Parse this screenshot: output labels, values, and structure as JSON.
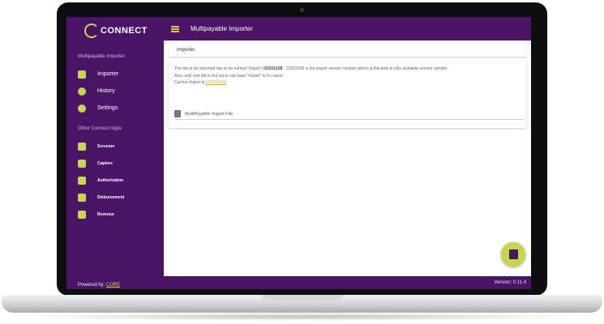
{
  "brand": {
    "name": "CONNECT"
  },
  "sidebar": {
    "section_title": "Multipayable Importer",
    "items": [
      {
        "label": "Importer",
        "icon": "import-icon"
      },
      {
        "label": "History",
        "icon": "history-icon"
      },
      {
        "label": "Settings",
        "icon": "gear-icon"
      }
    ],
    "apps_title": "Other Connect Apps",
    "apps": [
      {
        "label": "Screener",
        "icon": "screener-icon"
      },
      {
        "label": "Capture",
        "icon": "camera-icon"
      },
      {
        "label": "Authorization",
        "icon": "signature-icon"
      },
      {
        "label": "Disbursement",
        "icon": "send-icon"
      },
      {
        "label": "Revenue",
        "icon": "card-icon"
      }
    ],
    "powered_prefix": "Powered by:",
    "powered_link": "CORE"
  },
  "header": {
    "title": "Multipayable Importer"
  },
  "main": {
    "tab": "Importer",
    "info_line1_a": "The tab to be imported has to be named \"Import V",
    "info_line1_b": "20201028",
    "info_line1_c": "\". 20201028 is the import version number which at this time is only available version number.",
    "info_line2": "Also, only one tab in the excel can have \"Import\" in it's name.",
    "info_line3_prefix": "Current Import is",
    "info_line3_link": "V20201028",
    "file_label": "MultiPayable Import File"
  },
  "footer": {
    "version": "Version: 0.11.4"
  },
  "colors": {
    "primary": "#4a1466",
    "accent": "#c8d64b"
  }
}
